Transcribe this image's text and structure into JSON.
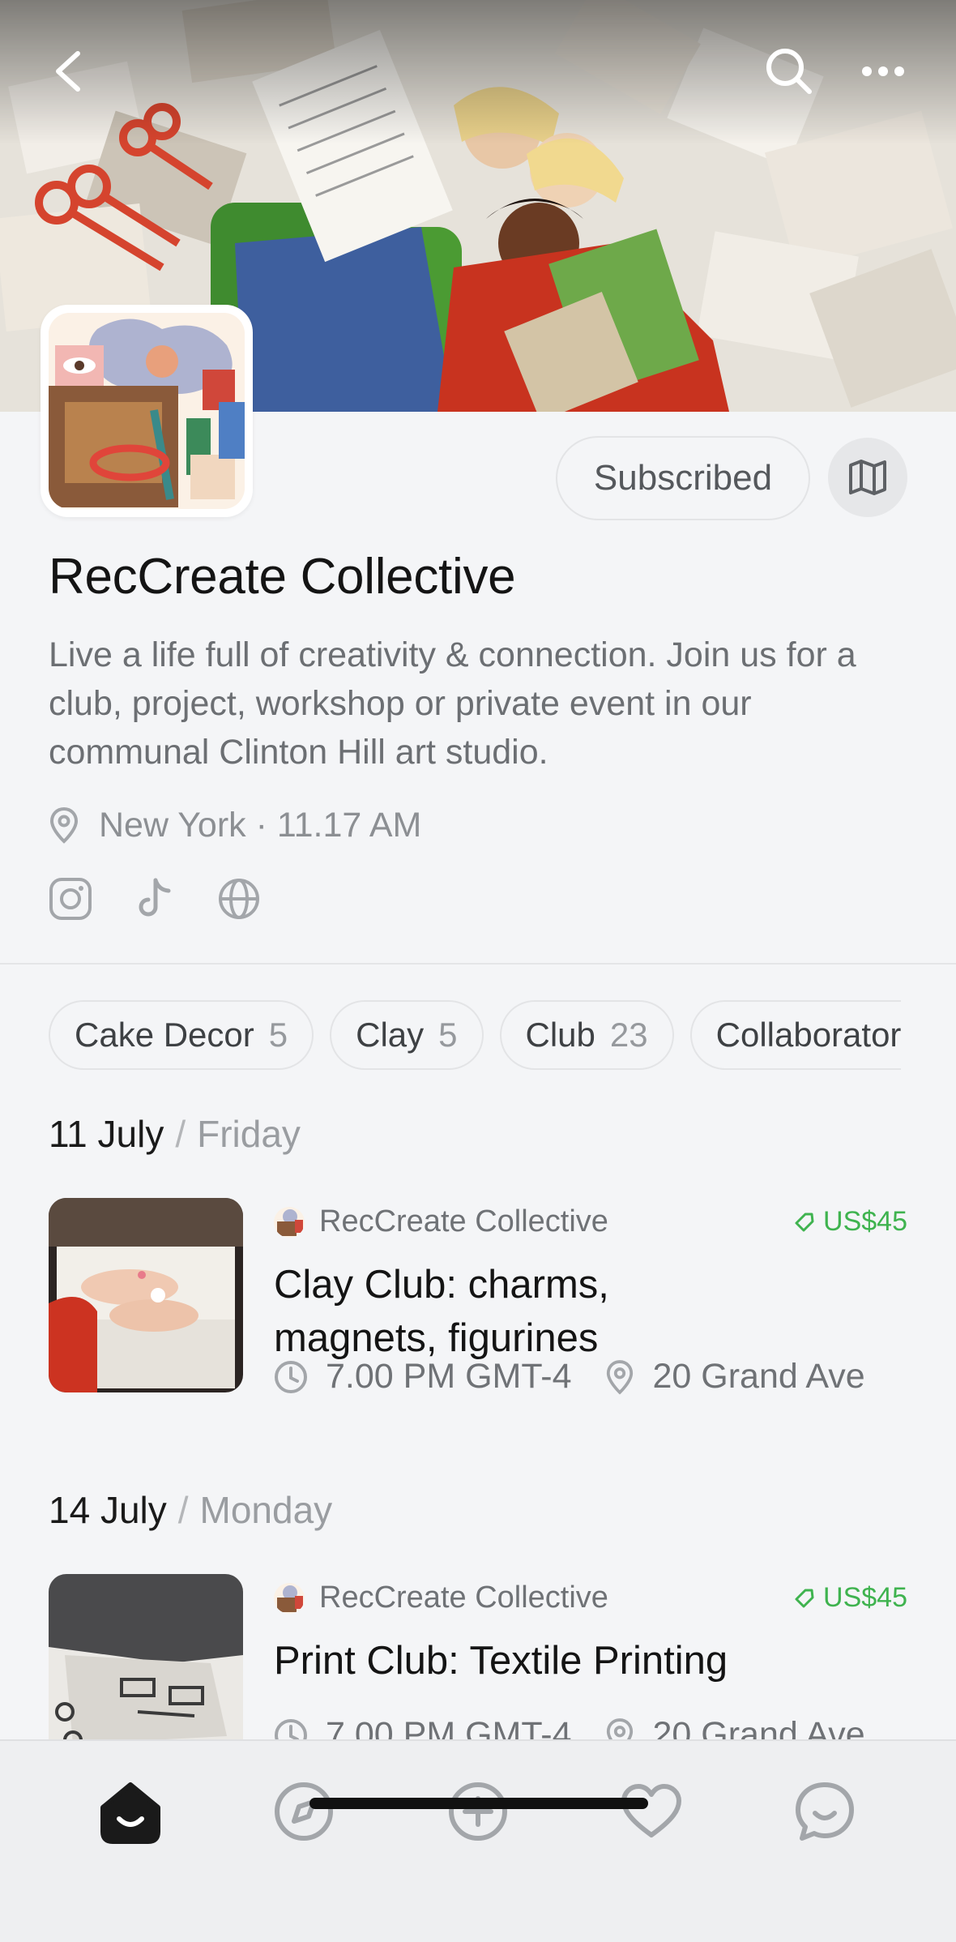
{
  "header": {
    "back_icon": "chevron-left-icon",
    "search_icon": "search-icon",
    "more_icon": "more-horizontal-icon"
  },
  "profile": {
    "name": "RecCreate Collective",
    "description": "Live a life full of creativity & connection. Join us for a club, project, workshop or private event in our communal Clinton Hill art studio.",
    "location": "New York",
    "local_time": "11.17 AM",
    "location_line": "New York · 11.17 AM",
    "subscribe_label": "Subscribed",
    "socials": [
      "instagram-icon",
      "tiktok-icon",
      "globe-icon"
    ]
  },
  "categories": [
    {
      "label": "Cake Decor",
      "count": "5"
    },
    {
      "label": "Clay",
      "count": "5"
    },
    {
      "label": "Club",
      "count": "23"
    },
    {
      "label": "Collaborator",
      "count": ""
    }
  ],
  "schedule": [
    {
      "date": "11 July",
      "weekday": "Friday",
      "event": {
        "host": "RecCreate Collective",
        "price": "US$45",
        "title": "Clay Club: charms, magnets, figurines",
        "time": "7.00 PM GMT-4",
        "place": "20 Grand Ave"
      }
    },
    {
      "date": "14 July",
      "weekday": "Monday",
      "event": {
        "host": "RecCreate Collective",
        "price": "US$45",
        "title": "Print Club: Textile Printing",
        "time": "7.00 PM GMT-4",
        "place": "20 Grand Ave"
      }
    }
  ],
  "tabbar": {
    "items": [
      "home-icon",
      "explore-compass-icon",
      "create-plus-icon",
      "favorites-heart-icon",
      "messages-chat-icon"
    ],
    "active": "home-icon"
  },
  "colors": {
    "accent_green": "#3fb34f",
    "background": "#f4f5f7",
    "text_primary": "#141414",
    "text_secondary": "#6f7276"
  }
}
